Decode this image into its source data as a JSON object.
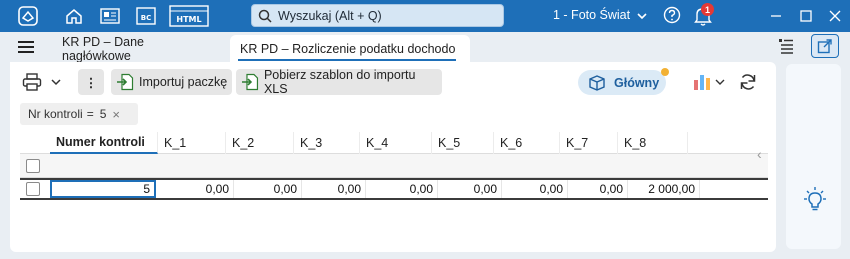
{
  "title_bar": {
    "search_placeholder": "Wyszukaj (Alt + Q)",
    "company": "1 - Foto Świat",
    "notification_count": "1",
    "icons": [
      "app-logo-icon",
      "home-icon",
      "news-icon",
      "bc-icon",
      "html-icon",
      "search-icon",
      "chevron-down-icon",
      "help-icon",
      "bell-icon",
      "minimize-icon",
      "maximize-icon",
      "close-icon"
    ],
    "bc_label": "BC",
    "html_label": "HTML"
  },
  "tabs": [
    {
      "label": "KR PD – Dane nagłówkowe",
      "active": false
    },
    {
      "label": "KR PD – Rozliczenie podatku dochodo",
      "active": true
    }
  ],
  "toolbar": {
    "more_label": "⋮",
    "import_label": "Importuj paczkę",
    "template_label": "Pobierz szablon do importu XLS",
    "view_label": "Główny"
  },
  "filter_chip": {
    "field": "Nr kontroli",
    "operator": "=",
    "value": "5",
    "remove": "×"
  },
  "grid": {
    "columns": [
      "Numer kontroli",
      "K_1",
      "K_2",
      "K_3",
      "K_4",
      "K_5",
      "K_6",
      "K_7",
      "K_8"
    ],
    "rows": [
      [
        "5",
        "0,00",
        "0,00",
        "0,00",
        "0,00",
        "0,00",
        "0,00",
        "0,00",
        "2 000,00"
      ]
    ]
  },
  "colors": {
    "accent": "#1e6fb8",
    "badge": "#e53935",
    "status_dot": "#f2b134"
  }
}
